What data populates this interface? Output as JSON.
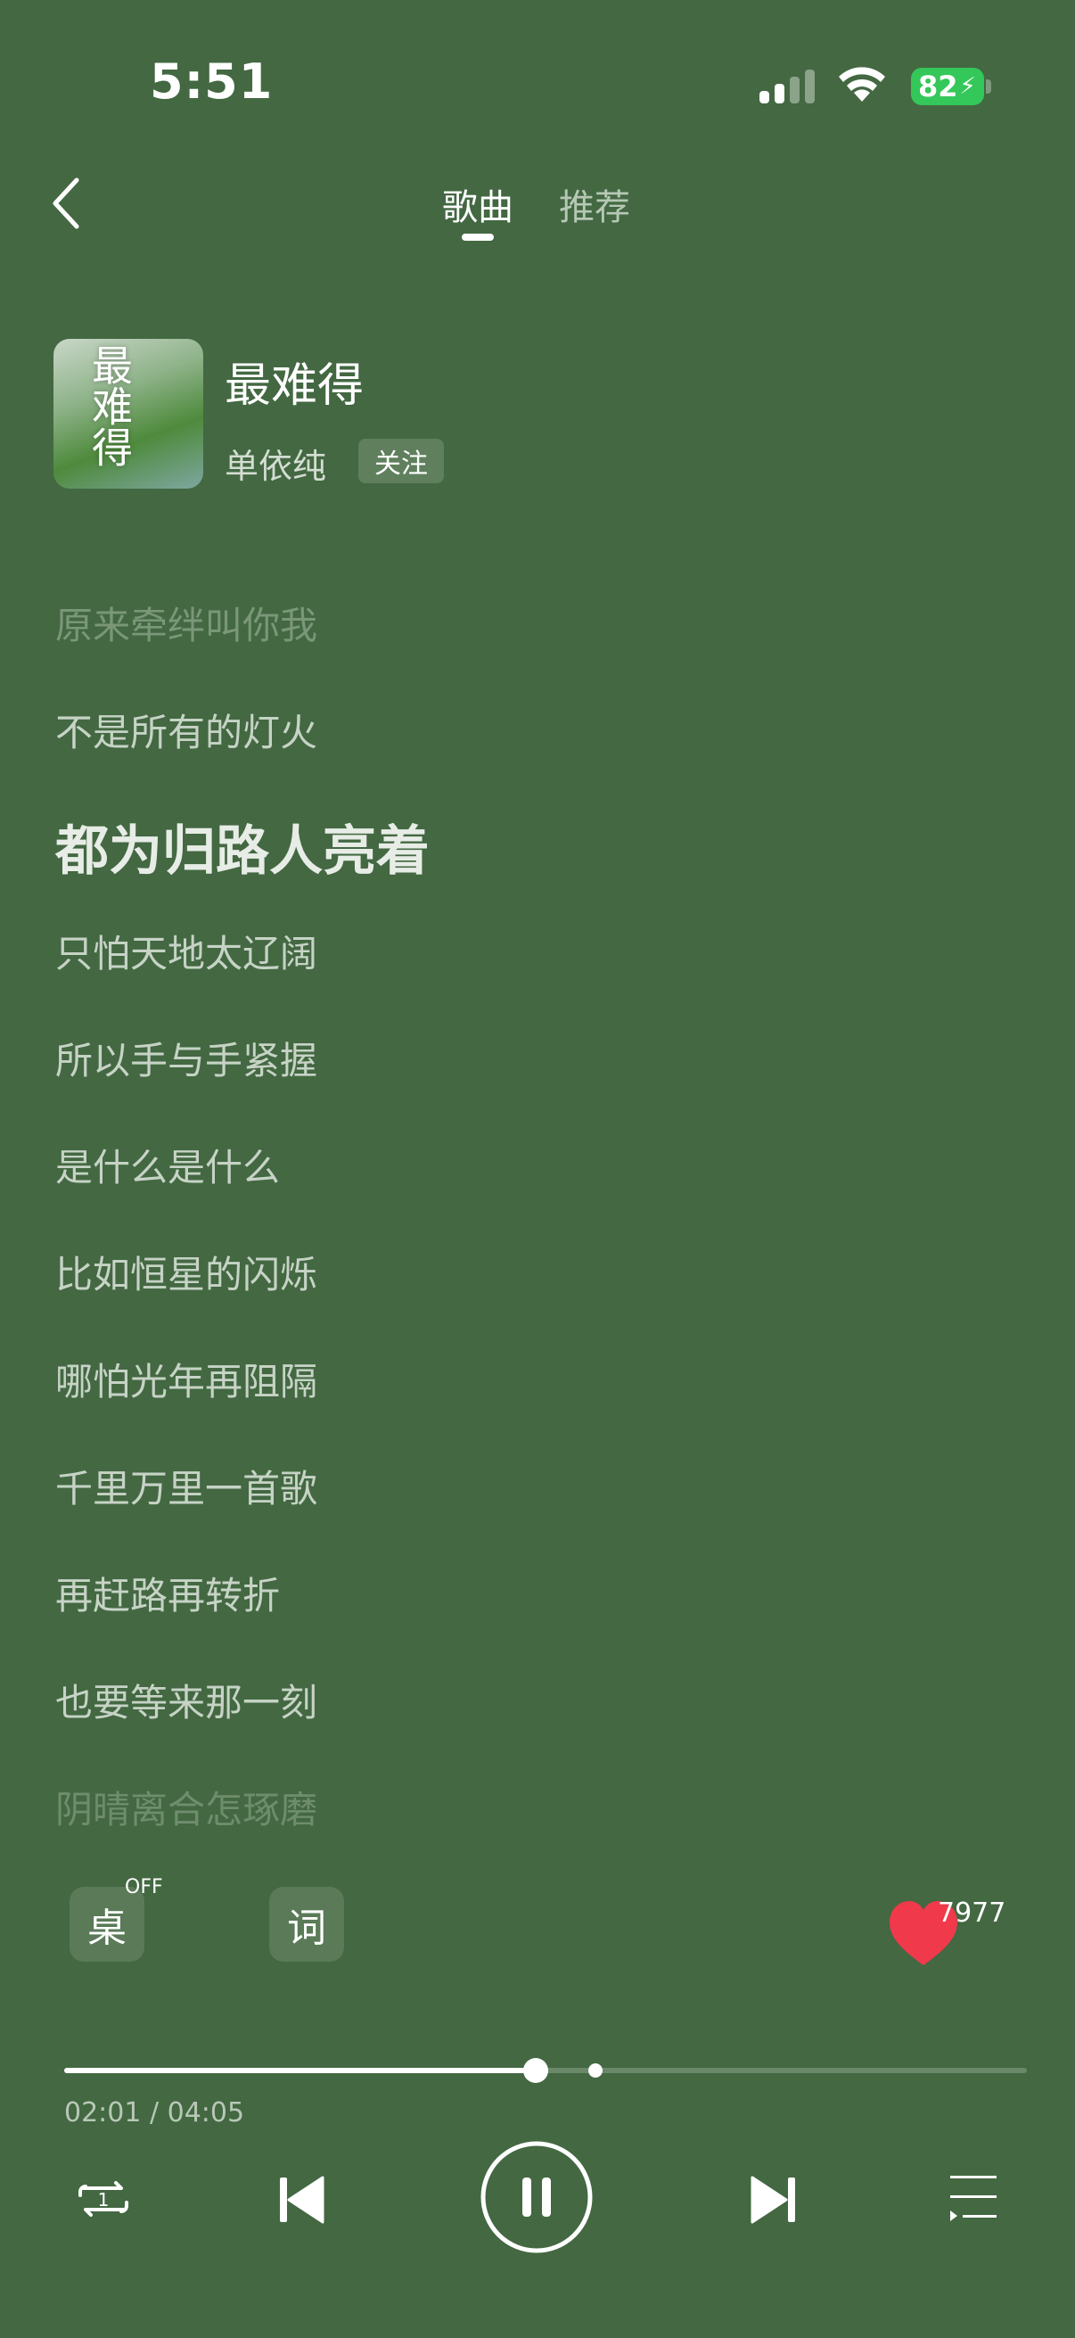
{
  "status_bar": {
    "time": "5:51",
    "battery": "82"
  },
  "nav": {
    "tabs": [
      {
        "label": "歌曲"
      },
      {
        "label": "推荐"
      }
    ]
  },
  "song": {
    "title": "最难得",
    "artist": "单依纯",
    "follow_label": "关注",
    "cover_text": "最难得"
  },
  "lyrics": [
    "原来牵绊叫你我",
    "不是所有的灯火",
    "都为归路人亮着",
    "只怕天地太辽阔",
    "所以手与手紧握",
    "是什么是什么",
    "比如恒星的闪烁",
    "哪怕光年再阻隔",
    "千里万里一首歌",
    "再赶路再转折",
    "也要等来那一刻",
    "阴晴离合怎琢磨"
  ],
  "tools": {
    "desktop_lyrics_label": "桌",
    "desktop_lyrics_state": "OFF",
    "lyrics_label": "词",
    "like_count": "7977"
  },
  "player": {
    "progress_text": "02:01 / 04:05",
    "progress_fraction": 0.49,
    "repeat_badge": "1"
  },
  "colors": {
    "background": "#436842",
    "heart": "#f0394b",
    "battery": "#34c759"
  },
  "icons": [
    "back-icon",
    "repeat-one-icon",
    "previous-icon",
    "pause-icon",
    "next-icon",
    "playlist-icon",
    "heart-icon",
    "wifi-icon",
    "signal-icon"
  ]
}
